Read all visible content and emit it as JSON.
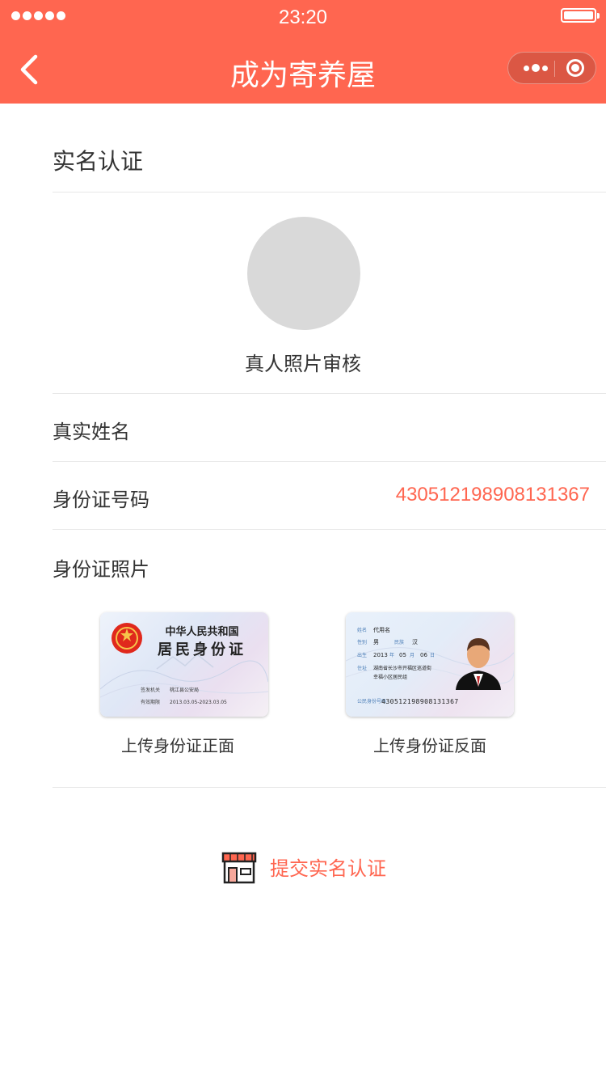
{
  "status_bar": {
    "time": "23:20"
  },
  "nav": {
    "title": "成为寄养屋"
  },
  "section": {
    "title": "实名认证"
  },
  "photo": {
    "label": "真人照片审核"
  },
  "fields": {
    "name_label": "真实姓名",
    "id_label": "身份证号码",
    "id_value": "430512198908131367",
    "id_photo_label": "身份证照片"
  },
  "card_front": {
    "line1": "中华人民共和国",
    "line2": "居民身份证",
    "authority_label": "签发机关",
    "authority_value": "桃江县公安局",
    "validity_label": "有效期限",
    "validity_value": "2013.03.05-2023.03.05",
    "upload_label": "上传身份证正面"
  },
  "card_back": {
    "name_label": "姓名",
    "name_value": "代用名",
    "gender_label": "性别",
    "gender_value": "男",
    "ethnic_label": "民族",
    "ethnic_value": "汉",
    "birth_label": "出生",
    "birth_year": "2013",
    "birth_year_unit": "年",
    "birth_month": "05",
    "birth_month_unit": "月",
    "birth_day": "06",
    "birth_day_unit": "日",
    "address_label": "住址",
    "address_line1": "湖南省长沙市开福区巡道街",
    "address_line2": "幸福小区居民组",
    "number_label": "公民身份号码",
    "number_value": "430512198908131367",
    "upload_label": "上传身份证反面"
  },
  "submit": {
    "label": "提交实名认证"
  },
  "colors": {
    "accent": "#ff6650"
  }
}
